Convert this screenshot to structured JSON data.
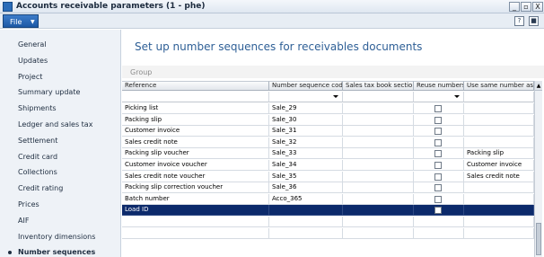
{
  "window": {
    "title": "Accounts receivable parameters (1 - phe)",
    "controls": [
      "_",
      "▫",
      "X"
    ]
  },
  "menubar": {
    "file_label": "File",
    "file_caret": "▼",
    "icons": [
      "?",
      "■"
    ]
  },
  "nav": {
    "items": [
      {
        "label": "General",
        "selected": false
      },
      {
        "label": "Updates",
        "selected": false
      },
      {
        "label": "Project",
        "selected": false
      },
      {
        "label": "Summary update",
        "selected": false
      },
      {
        "label": "Shipments",
        "selected": false
      },
      {
        "label": "Ledger and sales tax",
        "selected": false
      },
      {
        "label": "Settlement",
        "selected": false
      },
      {
        "label": "Credit card",
        "selected": false
      },
      {
        "label": "Collections",
        "selected": false
      },
      {
        "label": "Credit rating",
        "selected": false
      },
      {
        "label": "Prices",
        "selected": false
      },
      {
        "label": "AIF",
        "selected": false
      },
      {
        "label": "Inventory dimensions",
        "selected": false
      },
      {
        "label": "Number sequences",
        "selected": true
      }
    ]
  },
  "main": {
    "heading": "Set up number sequences for receivables documents",
    "group_label": "Group"
  },
  "grid": {
    "columns": [
      "Reference",
      "Number sequence code",
      "Sales tax book section",
      "Reuse numbers",
      "Use same number as"
    ],
    "scroll_up": "▲",
    "rows": [
      {
        "reference": "Picking list",
        "code": "Sale_29",
        "tax": "",
        "reuse": false,
        "same": "",
        "selected": false
      },
      {
        "reference": "Packing slip",
        "code": "Sale_30",
        "tax": "",
        "reuse": false,
        "same": "",
        "selected": false
      },
      {
        "reference": "Customer invoice",
        "code": "Sale_31",
        "tax": "",
        "reuse": false,
        "same": "",
        "selected": false
      },
      {
        "reference": "Sales credit note",
        "code": "Sale_32",
        "tax": "",
        "reuse": false,
        "same": "",
        "selected": false
      },
      {
        "reference": "Packing slip voucher",
        "code": "Sale_33",
        "tax": "",
        "reuse": false,
        "same": "Packing slip",
        "selected": false
      },
      {
        "reference": "Customer invoice voucher",
        "code": "Sale_34",
        "tax": "",
        "reuse": false,
        "same": "Customer invoice",
        "selected": false
      },
      {
        "reference": "Sales credit note voucher",
        "code": "Sale_35",
        "tax": "",
        "reuse": false,
        "same": "Sales credit note",
        "selected": false
      },
      {
        "reference": "Packing slip correction voucher",
        "code": "Sale_36",
        "tax": "",
        "reuse": false,
        "same": "",
        "selected": false
      },
      {
        "reference": "Batch number",
        "code": "Acco_365",
        "tax": "",
        "reuse": false,
        "same": "",
        "selected": false
      },
      {
        "reference": "Load ID",
        "code": "",
        "tax": "",
        "reuse": false,
        "same": "",
        "selected": true
      }
    ]
  },
  "colors": {
    "selection": "#0c2a6b",
    "heading": "#2e5f96",
    "file_button": "#2b6cb8"
  }
}
